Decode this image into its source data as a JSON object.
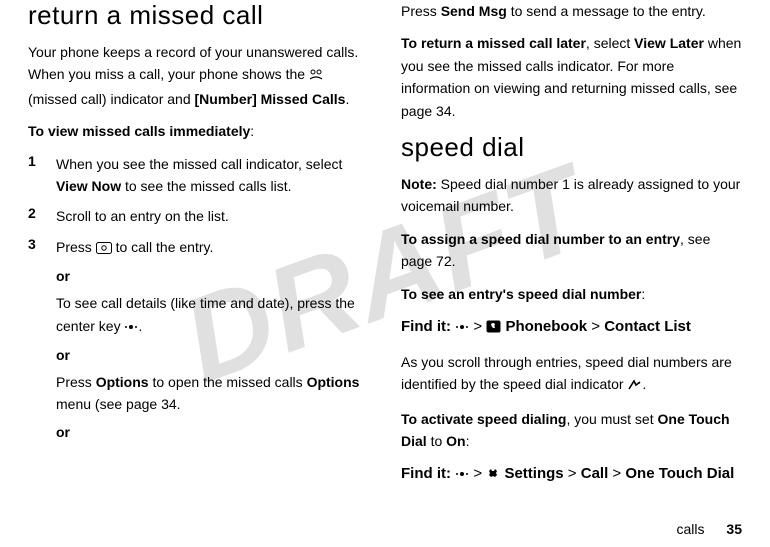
{
  "watermark": "DRAFT",
  "left": {
    "heading": "return a missed call",
    "intro_a": "Your phone keeps a record of your unanswered calls. When you miss a call, your phone shows the ",
    "intro_b": " (missed call) indicator and ",
    "intro_tag": "[Number] Missed Calls",
    "intro_c": ".",
    "view_label": "To view missed calls immediately",
    "steps": {
      "s1_a": "When you see the missed call indicator, select ",
      "s1_view_now": "View Now",
      "s1_b": " to see the missed calls list.",
      "s2": "Scroll to an entry on the list.",
      "s3_a": "Press ",
      "s3_b": " to call the entry."
    },
    "or": "or",
    "detail_a": "To see call details (like time and date), press the center key ",
    "detail_b": ".",
    "options_a": "Press ",
    "options_label": "Options",
    "options_b": " to open the missed calls ",
    "options_c": " menu (see page 34."
  },
  "right": {
    "sendmsg_a": "Press ",
    "sendmsg_label": "Send Msg",
    "sendmsg_b": " to send a message to the entry.",
    "return_a": "To return a missed call later",
    "return_b": ", select ",
    "return_view_later": "View Later",
    "return_c": " when you see the missed calls indicator. For more information on viewing and returning missed calls, see page 34.",
    "heading": "speed dial",
    "note_a": "Note:",
    "note_b": " Speed dial number 1 is already assigned to your voicemail number.",
    "assign_a": "To assign a speed dial number to an entry",
    "assign_b": ", see page 72.",
    "see_label": "To see an entry's speed dial number",
    "findit": "Find it:",
    "nav1_a": " > ",
    "nav1_pb": "Phonebook",
    "nav1_b": " > ",
    "nav1_cl": "Contact List",
    "scroll_a": "As you scroll through entries, speed dial numbers are identified by the speed dial indicator ",
    "scroll_b": ".",
    "activate_a": "To activate speed dialing",
    "activate_b": ", you must set ",
    "activate_otd": "One Touch Dial",
    "activate_c": " to ",
    "activate_on": "On",
    "activate_d": ":",
    "nav2_settings": "Settings",
    "nav2_call": "Call",
    "nav2_otd": "One Touch Dial"
  },
  "footer": {
    "section": "calls",
    "page": "35"
  }
}
